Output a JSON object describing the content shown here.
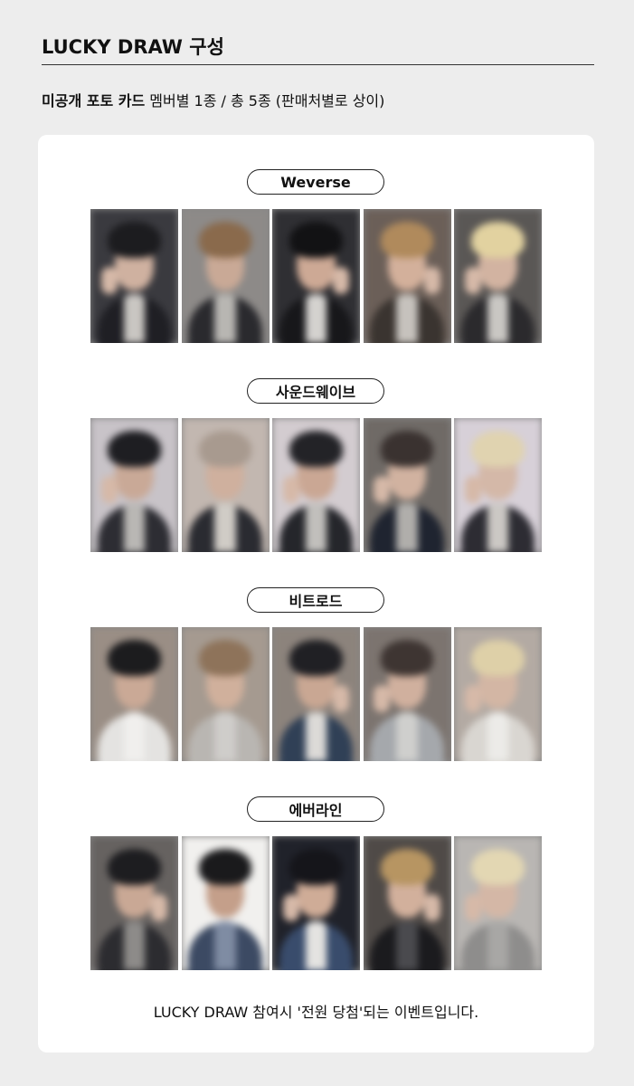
{
  "header": {
    "title": "LUCKY DRAW 구성"
  },
  "subtitle": {
    "bold": "미공개 포토 카드",
    "rest": " 멤버별 1종 / 총 5종 (판매처별로 상이)"
  },
  "sections": [
    {
      "label": "Weverse",
      "photos": [
        {
          "bg": "#3a3a3f",
          "hair": "#1c1c1f",
          "face": "#cfb1a0",
          "body": "#1f1f24",
          "shirt": "#c9c6c2",
          "hand": "left"
        },
        {
          "bg": "#8d8a88",
          "hair": "#8a6a4c",
          "face": "#c9a996",
          "body": "#2a2a2e",
          "shirt": "#b8b6b2",
          "hand": "none"
        },
        {
          "bg": "#2f2f33",
          "hair": "#121214",
          "face": "#cda995",
          "body": "#17171a",
          "shirt": "#d4d2cf",
          "hand": "right"
        },
        {
          "bg": "#6b5f58",
          "hair": "#b08a5c",
          "face": "#d3b09b",
          "body": "#3a3430",
          "shirt": "#c6c2bd",
          "hand": "right"
        },
        {
          "bg": "#5a5755",
          "hair": "#e2d2a0",
          "face": "#d2b3a1",
          "body": "#2b2a2d",
          "shirt": "#c9c7c3",
          "hand": "left"
        }
      ]
    },
    {
      "label": "사운드웨이브",
      "photos": [
        {
          "bg": "#c8c3c8",
          "hair": "#1e1e22",
          "face": "#c9a997",
          "body": "#2d2d33",
          "shirt": "#b9b7b4",
          "hand": "left"
        },
        {
          "bg": "#c2b7b0",
          "hair": "#a89a8f",
          "face": "#cfb09e",
          "body": "#2a2b31",
          "shirt": "#d0ccc6",
          "hand": "none"
        },
        {
          "bg": "#d3ccd0",
          "hair": "#232327",
          "face": "#caa794",
          "body": "#25262b",
          "shirt": "#c1bfbc",
          "hand": "left"
        },
        {
          "bg": "#6f6a66",
          "hair": "#3a3230",
          "face": "#d1b2a0",
          "body": "#1f2430",
          "shirt": "#b0aeab",
          "hand": "left"
        },
        {
          "bg": "#d7d0d8",
          "hair": "#e0d3b0",
          "face": "#d4b8a8",
          "body": "#2d2c33",
          "shirt": "#cbc8c4",
          "hand": "left"
        }
      ]
    },
    {
      "label": "비트로드",
      "photos": [
        {
          "bg": "#9a8e85",
          "hair": "#1c1c1e",
          "face": "#caa996",
          "body": "#e4e3e1",
          "shirt": "#f0efed",
          "hand": "none"
        },
        {
          "bg": "#a59a90",
          "hair": "#8e735a",
          "face": "#d0b09c",
          "body": "#b9b6b2",
          "shirt": "#cfcdca",
          "hand": "none"
        },
        {
          "bg": "#8c837c",
          "hair": "#202024",
          "face": "#c9a793",
          "body": "#304056",
          "shirt": "#dcdad7",
          "hand": "right"
        },
        {
          "bg": "#7c746f",
          "hair": "#3e3532",
          "face": "#d0b09e",
          "body": "#a5a8ac",
          "shirt": "#cfcfcd",
          "hand": "left"
        },
        {
          "bg": "#b3aaa3",
          "hair": "#ded0a8",
          "face": "#d3b6a4",
          "body": "#d9d6d1",
          "shirt": "#ecebe8",
          "hand": "left"
        }
      ]
    },
    {
      "label": "에버라인",
      "photos": [
        {
          "bg": "#666260",
          "hair": "#1d1d20",
          "face": "#c9a895",
          "body": "#2c2c30",
          "shirt": "#8d8b89",
          "hand": "right"
        },
        {
          "bg": "#f1f0ee",
          "hair": "#1a1a1c",
          "face": "#c49f8a",
          "body": "#3c4a63",
          "shirt": "#7f8ca3",
          "hand": "none"
        },
        {
          "bg": "#20222a",
          "hair": "#15151a",
          "face": "#cfac97",
          "body": "#394c6c",
          "shirt": "#e4e3e1",
          "hand": "left"
        },
        {
          "bg": "#4f4a47",
          "hair": "#b79562",
          "face": "#d2b09c",
          "body": "#1b1b1e",
          "shirt": "#4a4a4e",
          "hand": "right"
        },
        {
          "bg": "#b9b6b3",
          "hair": "#e3d7b3",
          "face": "#d4b7a6",
          "body": "#8e8d8c",
          "shirt": "#a8a7a5",
          "hand": "left"
        }
      ]
    }
  ],
  "footer": {
    "note": "LUCKY DRAW 참여시 '전원 당첨'되는 이벤트입니다."
  }
}
